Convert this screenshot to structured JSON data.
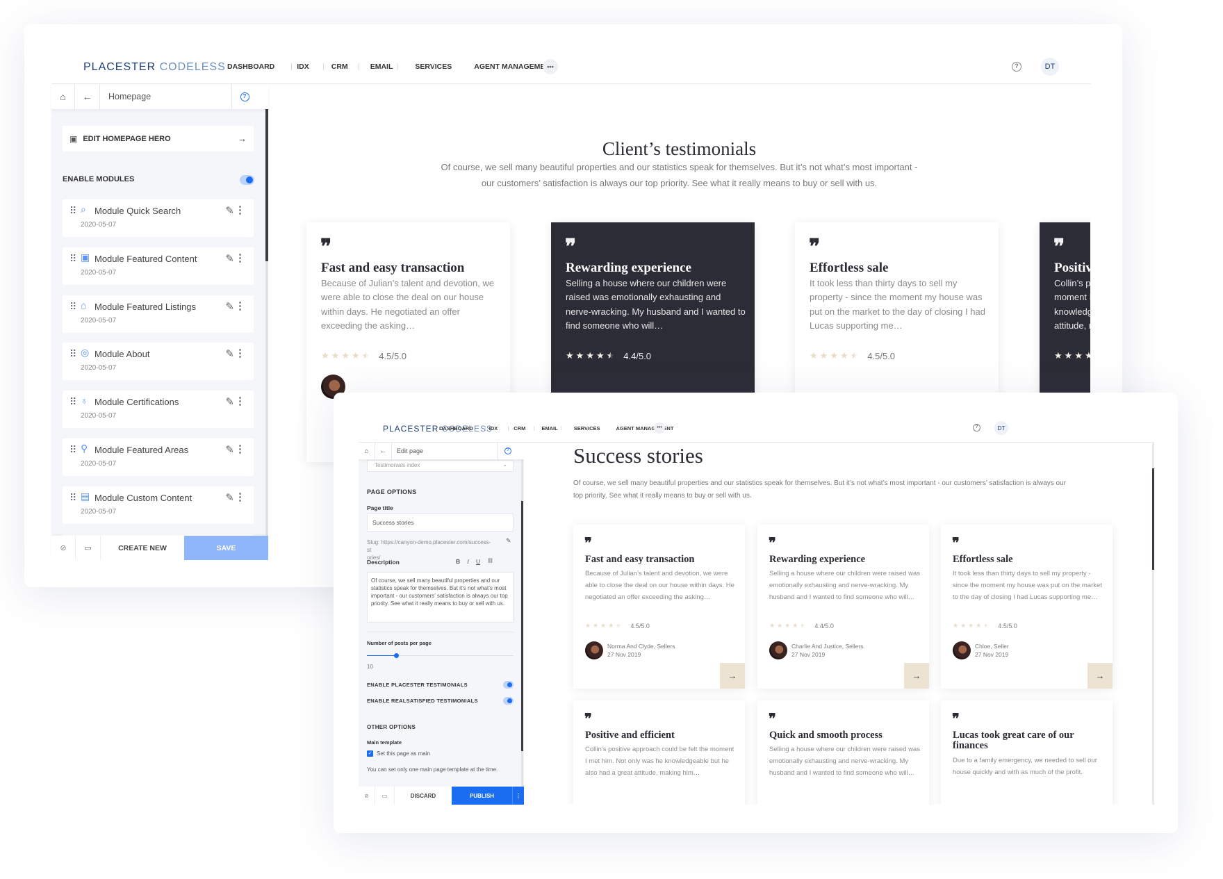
{
  "back": {
    "header": {
      "logo_bold": "PLACESTER",
      "logo_light": "CODELESS",
      "nav": [
        "DASHBOARD",
        "IDX",
        "CRM",
        "EMAIL",
        "SERVICES",
        "AGENT MANAGEMENT"
      ],
      "more": "•••",
      "help": "?",
      "avatar": "DT"
    },
    "sidebar": {
      "breadcrumb": "Homepage",
      "help": "?",
      "edit_hero": "EDIT HOMEPAGE HERO",
      "enable_modules": "ENABLE MODULES",
      "enable_modules_on": true,
      "modules": [
        {
          "name": "Module Quick Search",
          "date": "2020-05-07",
          "icon": "search-icon"
        },
        {
          "name": "Module Featured Content",
          "date": "2020-05-07",
          "icon": "content-icon"
        },
        {
          "name": "Module Featured Listings",
          "date": "2020-05-07",
          "icon": "home-icon"
        },
        {
          "name": "Module About",
          "date": "2020-05-07",
          "icon": "user-icon"
        },
        {
          "name": "Module Certifications",
          "date": "2020-05-07",
          "icon": "badge-icon"
        },
        {
          "name": "Module Featured Areas",
          "date": "2020-05-07",
          "icon": "pin-icon"
        },
        {
          "name": "Module Custom Content",
          "date": "2020-05-07",
          "icon": "layout-icon"
        }
      ],
      "footer": {
        "create": "CREATE NEW",
        "save": "SAVE"
      }
    },
    "content": {
      "title": "Client’s testimonials",
      "subtitle_1": "Of course, we sell many beautiful properties and our statistics speak for themselves. But it’s not what’s most important -",
      "subtitle_2": "our customers’ satisfaction is always our top priority. See what it really means to buy or sell with us.",
      "cards": [
        {
          "title": "Fast and easy transaction",
          "body": "Because of Julian’s talent and devotion, we were able to close the deal on our house within days. He negotiated an offer exceeding the asking…",
          "rating": "4.5/5.0",
          "stars": 4.5,
          "dark": false
        },
        {
          "title": "Rewarding experience",
          "body": "Selling a house where our children were raised was emotionally exhausting and nerve-wracking. My husband and I wanted to find someone who will…",
          "rating": "4.4/5.0",
          "stars": 4.5,
          "dark": true
        },
        {
          "title": "Effortless sale",
          "body": "It took less than thirty days to sell my property - since the moment my house was put on the market to the day of closing I had Lucas supporting me…",
          "rating": "4.5/5.0",
          "stars": 4.5,
          "dark": false
        },
        {
          "title": "Positive and efficient",
          "body": "Collin’s positive approach could be felt the moment I met him. Not only was he knowledgeable but he also had a great attitude, making him…",
          "rating": "",
          "stars": 4.5,
          "dark": true
        }
      ]
    }
  },
  "front": {
    "header": {
      "logo_bold": "PLACESTER",
      "logo_light": "CODELESS",
      "nav": [
        "DASHBOARD",
        "IDX",
        "CRM",
        "EMAIL",
        "SERVICES",
        "AGENT MANAGEMENT"
      ],
      "more": "•••",
      "help": "?",
      "avatar": "DT"
    },
    "sidebar": {
      "breadcrumb": "Edit page",
      "help": "?",
      "template_select": "Testimonials index",
      "page_options": "PAGE OPTIONS",
      "page_title_label": "Page title",
      "page_title_value": "Success stories",
      "slug_label": "Slug:",
      "slug": "https://canyon-demo.placester.com/success-st",
      "slug_2": "ories/",
      "description_label": "Description",
      "format": {
        "bold": "B",
        "italic": "I",
        "underline": "U",
        "link": "🔗"
      },
      "description": "Of course, we sell many beautiful properties and our statistics speak for themselves. But it’s not what’s most important - our customers’ satisfaction is always our top priority. See what it really means to buy or sell with us.",
      "posts_label": "Number of posts per page",
      "posts_value": "10",
      "posts_slider_fraction": 0.2,
      "placester_toggle": "ENABLE PLACESTER TESTIMONIALS",
      "placester_on": true,
      "realsatisfied_toggle": "ENABLE REALSATISFIED TESTIMONIALS",
      "realsatisfied_on": true,
      "other_options": "OTHER OPTIONS",
      "main_template_label": "Main template",
      "main_checkbox": "Set this page as main",
      "main_checked": true,
      "note": "You can set only one main page template at the time.",
      "footer": {
        "discard": "DISCARD",
        "publish": "PUBLISH",
        "more": "⋮"
      }
    },
    "content": {
      "title": "Success stories",
      "desc_1": "Of course, we sell many beautiful properties and our statistics speak for themselves. But it’s not what’s most important - our customers’ satisfaction is always our",
      "desc_2": "top priority. See what it really means to buy or sell with us.",
      "cards": [
        {
          "title": "Fast and easy transaction",
          "body": "Because of Julian’s talent and devotion, we were able to close the deal on our house within days. He negotiated an offer exceeding the asking…",
          "rating": "4.5/5.0",
          "stars": 4.5,
          "author": "Norma And Clyde, Sellers",
          "date": "27 Nov 2019"
        },
        {
          "title": "Rewarding experience",
          "body": "Selling a house where our children were raised was emotionally exhausting and nerve-wracking. My husband and I wanted to find someone who will…",
          "rating": "4.4/5.0",
          "stars": 4.5,
          "author": "Charlie And Justice, Sellers",
          "date": "27 Nov 2019"
        },
        {
          "title": "Effortless sale",
          "body": "It took less than thirty days to sell my property - since the moment my house was put on the market to the day of closing I had Lucas supporting me…",
          "rating": "4.5/5.0",
          "stars": 4.5,
          "author": "Chloe, Seller",
          "date": "27 Nov 2019"
        },
        {
          "title": "Positive and efficient",
          "body": "Collin’s positive approach could be felt the moment I met him. Not only was he knowledgeable but he also had a great attitude, making him…"
        },
        {
          "title": "Quick and smooth process",
          "body": "Selling a house where our children were raised was emotionally exhausting and nerve-wracking. My husband and I wanted to find someone who will…"
        },
        {
          "title": "Lucas took great care of our finances",
          "body": "Due to a family emergency, we needed to sell our house quickly and with as much of the profit."
        }
      ]
    }
  },
  "colors": {
    "accent": "#1a6cf0",
    "save_disabled": "#8fb6f8",
    "dark_card": "#2c2c36",
    "beige": "#ece3d3"
  }
}
